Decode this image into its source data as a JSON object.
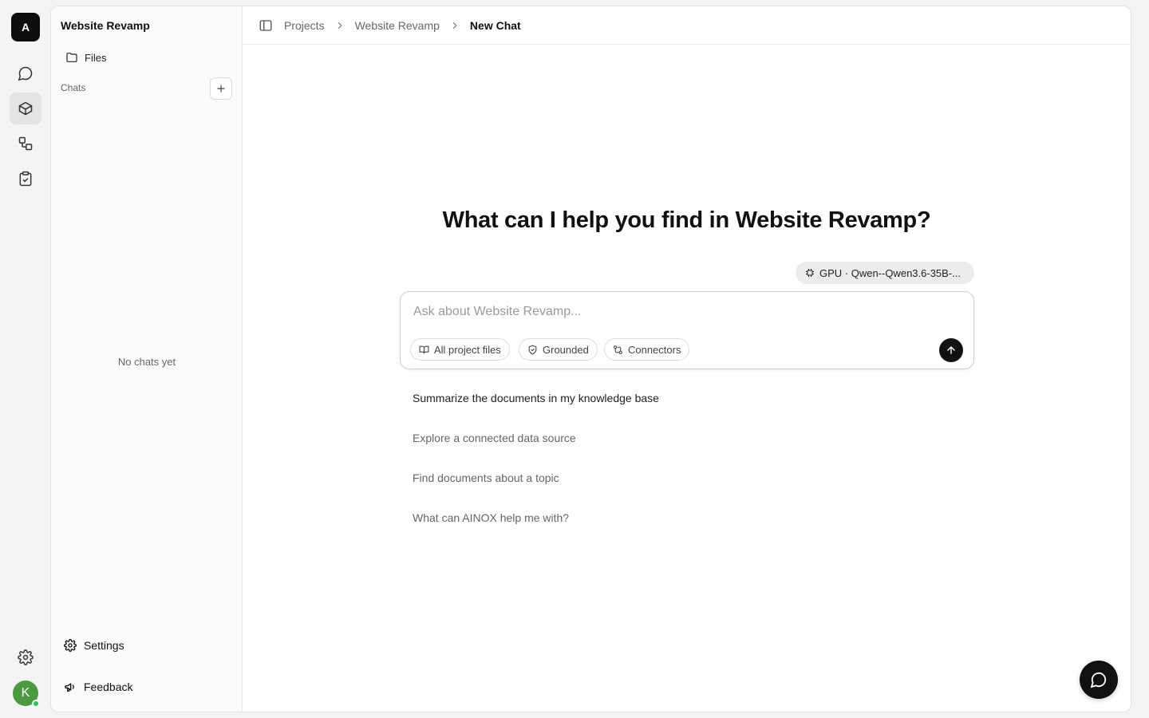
{
  "rail": {
    "logo_letter": "A",
    "avatar_letter": "K"
  },
  "sidebar": {
    "project_title": "Website Revamp",
    "files_label": "Files",
    "chats_label": "Chats",
    "empty_text": "No chats yet",
    "settings_label": "Settings",
    "feedback_label": "Feedback"
  },
  "breadcrumb": {
    "items": [
      "Projects",
      "Website Revamp",
      "New Chat"
    ]
  },
  "main": {
    "headline": "What can I help you find in Website Revamp?",
    "model_chip": "GPU · Qwen--Qwen3.6-35B-...",
    "composer_placeholder": "Ask about Website Revamp...",
    "pills": {
      "files": "All project files",
      "grounded": "Grounded",
      "connectors": "Connectors"
    },
    "suggestions": [
      "Summarize the documents in my knowledge base",
      "Explore a connected data source",
      "Find documents about a topic",
      "What can AINOX help me with?"
    ]
  },
  "colors": {
    "accent": "#111111",
    "avatar": "#4c9a3f",
    "online": "#22c55e"
  }
}
